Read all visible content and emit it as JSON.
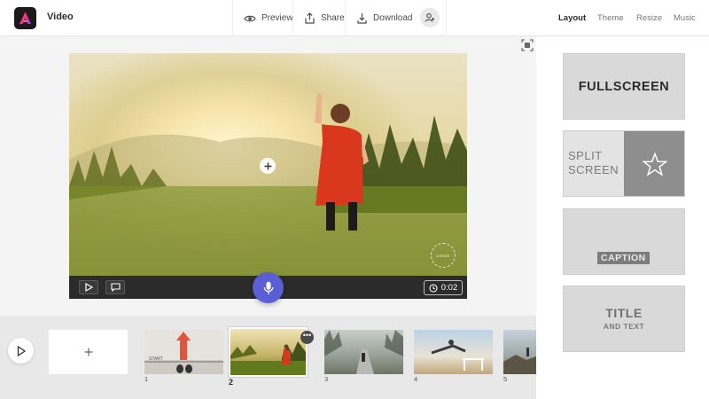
{
  "app": {
    "title": "Video",
    "logo_icon": "adobe-express-logo"
  },
  "toolbar": {
    "preview_label": "Preview",
    "share_label": "Share",
    "download_label": "Download"
  },
  "right_tabs": [
    {
      "label": "Layout",
      "active": true
    },
    {
      "label": "Theme",
      "active": false
    },
    {
      "label": "Resize",
      "active": false
    },
    {
      "label": "Music",
      "active": false
    }
  ],
  "canvas": {
    "logo_placeholder": "LOGO",
    "duration": "0:02"
  },
  "timeline": {
    "slides": [
      {
        "number": "1",
        "caption": "START"
      },
      {
        "number": "2",
        "active": true
      },
      {
        "number": "3"
      },
      {
        "number": "4"
      },
      {
        "number": "5"
      }
    ],
    "more_label": "•••"
  },
  "layouts": {
    "fullscreen": "FULLSCREEN",
    "split_line1": "SPLIT",
    "split_line2": "SCREEN",
    "caption": "CAPTION",
    "title_main": "TITLE",
    "title_sub": "AND TEXT"
  },
  "colors": {
    "accent": "#5a5fd6",
    "bar_dark": "#2b2b2b"
  }
}
